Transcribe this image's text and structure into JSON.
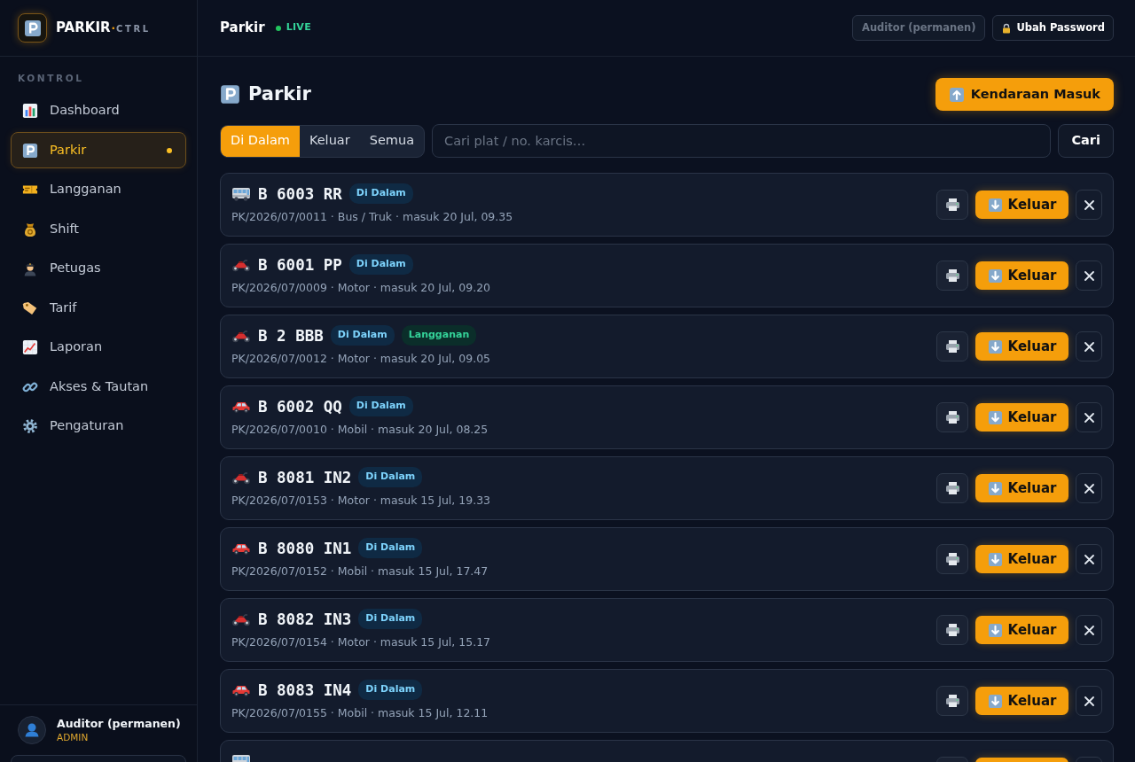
{
  "sidebar": {
    "brand": {
      "name": "PARKIR",
      "separator": "·",
      "suffix": "CTRL"
    },
    "section_label": "KONTROL",
    "items": [
      {
        "label": "Dashboard",
        "selected": false
      },
      {
        "label": "Parkir",
        "selected": true
      },
      {
        "label": "Langganan",
        "selected": false
      },
      {
        "label": "Shift",
        "selected": false
      },
      {
        "label": "Petugas",
        "selected": false
      },
      {
        "label": "Tarif",
        "selected": false
      },
      {
        "label": "Laporan",
        "selected": false
      },
      {
        "label": "Akses & Tautan",
        "selected": false
      },
      {
        "label": "Pengaturan",
        "selected": false
      }
    ],
    "user": {
      "name": "Auditor (permanen)",
      "role": "ADMIN"
    }
  },
  "header": {
    "title": "Parkir",
    "status": "LIVE",
    "user_label": "Auditor (permanen)",
    "password_button": "Ubah Password"
  },
  "page": {
    "title": "Parkir",
    "primary_button": "Kendaraan Masuk"
  },
  "filter_tabs": [
    {
      "label": "Di Dalam",
      "selected": true
    },
    {
      "label": "Keluar",
      "selected": false
    },
    {
      "label": "Semua",
      "selected": false
    }
  ],
  "search": {
    "placeholder": "Cari plat / no. karcis…",
    "button": "Cari"
  },
  "vehicles": [
    {
      "kind": "bus",
      "plate": "B 6003 RR",
      "badges": [
        {
          "kind": "status",
          "label": "Di Dalam"
        }
      ],
      "meta": "PK/2026/07/0011 · Bus / Truk · masuk 20 Jul, 09.35",
      "exit_button": "Keluar"
    },
    {
      "kind": "motorcycle",
      "plate": "B 6001 PP",
      "badges": [
        {
          "kind": "status",
          "label": "Di Dalam"
        }
      ],
      "meta": "PK/2026/07/0009 · Motor · masuk 20 Jul, 09.20",
      "exit_button": "Keluar"
    },
    {
      "kind": "motorcycle",
      "plate": "B 2 BBB",
      "badges": [
        {
          "kind": "status",
          "label": "Di Dalam"
        },
        {
          "kind": "subscription",
          "label": "Langganan"
        }
      ],
      "meta": "PK/2026/07/0012 · Motor · masuk 20 Jul, 09.05",
      "exit_button": "Keluar"
    },
    {
      "kind": "car",
      "plate": "B 6002 QQ",
      "badges": [
        {
          "kind": "status",
          "label": "Di Dalam"
        }
      ],
      "meta": "PK/2026/07/0010 · Mobil · masuk 20 Jul, 08.25",
      "exit_button": "Keluar"
    },
    {
      "kind": "motorcycle",
      "plate": "B 8081 IN2",
      "badges": [
        {
          "kind": "status",
          "label": "Di Dalam"
        }
      ],
      "meta": "PK/2026/07/0153 · Motor · masuk 15 Jul, 19.33",
      "exit_button": "Keluar"
    },
    {
      "kind": "car",
      "plate": "B 8080 IN1",
      "badges": [
        {
          "kind": "status",
          "label": "Di Dalam"
        }
      ],
      "meta": "PK/2026/07/0152 · Mobil · masuk 15 Jul, 17.47",
      "exit_button": "Keluar"
    },
    {
      "kind": "motorcycle",
      "plate": "B 8082 IN3",
      "badges": [
        {
          "kind": "status",
          "label": "Di Dalam"
        }
      ],
      "meta": "PK/2026/07/0154 · Motor · masuk 15 Jul, 15.17",
      "exit_button": "Keluar"
    },
    {
      "kind": "car",
      "plate": "B 8083 IN4",
      "badges": [
        {
          "kind": "status",
          "label": "Di Dalam"
        }
      ],
      "meta": "PK/2026/07/0155 · Mobil · masuk 15 Jul, 12.11",
      "exit_button": "Keluar"
    },
    {
      "kind": "bus"
    }
  ]
}
